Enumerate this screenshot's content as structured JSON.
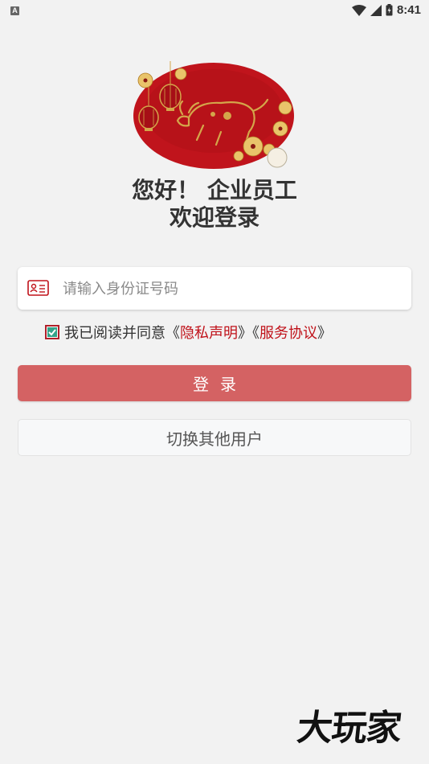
{
  "status_bar": {
    "app_indicator": "A",
    "time": "8:41",
    "icons": [
      "wifi-icon",
      "cellular-signal-icon",
      "battery-icon"
    ]
  },
  "logo": {
    "icon": "zodiac-ox-emblem"
  },
  "greeting": {
    "line1": "您好！ 企业员工",
    "line2": "欢迎登录"
  },
  "id_field": {
    "icon": "id-card-icon",
    "placeholder": "请输入身份证号码",
    "value": ""
  },
  "agreement": {
    "checked": true,
    "prefix": "我已阅读并同意《",
    "privacy_link": "隐私声明",
    "middle": "》《",
    "terms_link": "服务协议",
    "suffix": "》"
  },
  "login_button": {
    "label": "登录"
  },
  "switch_user_button": {
    "label": "切换其他用户"
  },
  "watermark": {
    "text": "大玩家"
  },
  "colors": {
    "background": "#f2f2f2",
    "primary_button": "#d46263",
    "link": "#c0121a",
    "logo_red": "#c0141c",
    "gold": "#d4a64a"
  }
}
